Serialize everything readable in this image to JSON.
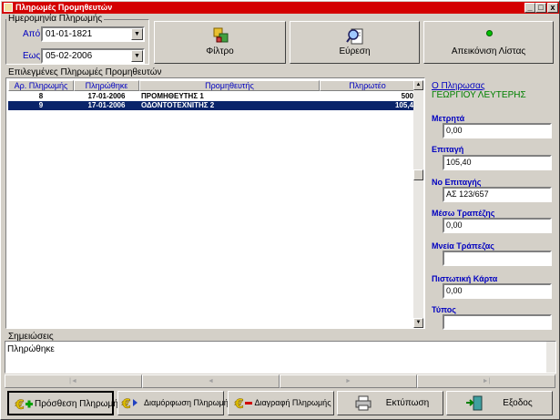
{
  "window": {
    "title": "Πληρωμές Προμηθευτών",
    "min": "_",
    "max": "□",
    "close": "x"
  },
  "date_group": {
    "title": "Ημερομηνία Πληρωμής",
    "from_label": "Από",
    "from_value": "01-01-1821",
    "to_label": "Εως",
    "to_value": "05-02-2006"
  },
  "toolbar": {
    "filter_label": "Φίλτρο",
    "search_label": "Εύρεση",
    "list_view_label": "Απεικόνιση Λίστας"
  },
  "grid": {
    "title": "Επιλεγμένες Πληρωμές Προμηθευτών",
    "columns": [
      "Αρ. Πληρωμής",
      "Πληρώθηκε",
      "Προμηθευτής",
      "Πληρωτέο"
    ],
    "rows": [
      {
        "num": "8",
        "date": "17-01-2006",
        "supplier": "ΠΡΟΜΗΘΕΥΤΗΣ 1",
        "amount": "500"
      },
      {
        "num": "9",
        "date": "17-01-2006",
        "supplier": "ΟΔΟΝΤΟΤΕΧΝΙΤΗΣ 2",
        "amount": "105,4"
      }
    ]
  },
  "details": {
    "payer_label": "Ο Πληρωσας",
    "payer_name": "ΓΕΩΡΓΙΟΥ ΛΕΥΤΕΡΗΣ",
    "cash_label": "Μετρητά",
    "cash_value": "0,00",
    "cheque_label": "Επιταγή",
    "cheque_value": "105,40",
    "cheque_no_label": "Νο Επιταγής",
    "cheque_no_value": "ΑΣ 123/657",
    "bank_label": "Μέσω Τραπέζης",
    "bank_value": "0,00",
    "bank_note_label": "Μνεία Τράπεζας",
    "bank_note_value": "",
    "card_label": "Πιστωτική Κάρτα",
    "card_value": "0,00",
    "type_label": "Τύπος",
    "type_value": ""
  },
  "notes": {
    "title": "Σημειώσεις",
    "text": "Πληρώθηκε"
  },
  "navigator": {
    "first": "|◄",
    "prev": "◄",
    "next": "►",
    "last": "►|"
  },
  "buttons": {
    "add": "Πρόσθεση Πληρωμής",
    "edit": "Διαμόρφωση Πληρωμής",
    "delete": "Διαγραφή Πληρωμής",
    "print": "Εκτύπωση",
    "exit": "Εξοδος"
  },
  "colors": {
    "title_bar": "#d40000",
    "selection": "#0a246a",
    "label_blue": "#0000c0",
    "payer_green": "#008000"
  }
}
